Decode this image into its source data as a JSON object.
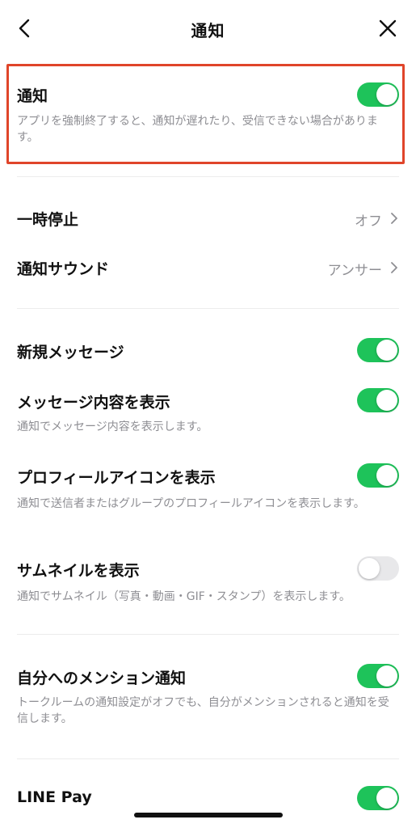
{
  "header": {
    "title": "通知",
    "back_icon": "chevron-left-icon",
    "close_icon": "close-icon"
  },
  "notification_main": {
    "title": "通知",
    "description": "アプリを強制終了すると、通知が遅れたり、受信できない場合があります。",
    "enabled": true
  },
  "pause": {
    "title": "一時停止",
    "value": "オフ"
  },
  "sound": {
    "title": "通知サウンド",
    "value": "アンサー"
  },
  "settings": {
    "new_message": {
      "title": "新規メッセージ",
      "enabled": true
    },
    "show_content": {
      "title": "メッセージ内容を表示",
      "description": "通知でメッセージ内容を表示します。",
      "enabled": true
    },
    "show_profile_icon": {
      "title": "プロフィールアイコンを表示",
      "description": "通知で送信者またはグループのプロフィールアイコンを表示します。",
      "enabled": true
    },
    "show_thumbnail": {
      "title": "サムネイルを表示",
      "description": "通知でサムネイル（写真・動画・GIF・スタンプ）を表示します。",
      "enabled": false
    },
    "mention": {
      "title": "自分へのメンション通知",
      "description": "トークルームの通知設定がオフでも、自分がメンションされると通知を受信します。",
      "enabled": true
    },
    "line_pay": {
      "title": "LINE Pay",
      "enabled": true
    }
  },
  "colors": {
    "accent_green": "#1ec35a",
    "highlight_red": "#e0452a",
    "secondary_text": "#8e8e93"
  }
}
